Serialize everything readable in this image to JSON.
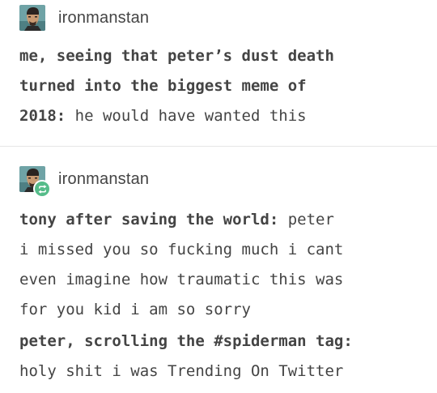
{
  "posts": [
    {
      "username": "ironmanstan",
      "reblogged": false,
      "lines": [
        {
          "bold": "me, seeing that peter’s dust death",
          "normal": ""
        },
        {
          "bold": "turned into the biggest meme of",
          "normal": ""
        },
        {
          "bold": "2018:",
          "normal": " he would have wanted this"
        }
      ]
    },
    {
      "username": "ironmanstan",
      "reblogged": true,
      "quotes": [
        {
          "lines": [
            {
              "bold": "tony after saving the world:",
              "normal": " peter"
            },
            {
              "bold": "",
              "normal": "i missed you so fucking much i cant"
            },
            {
              "bold": "",
              "normal": "even imagine how traumatic this was"
            },
            {
              "bold": "",
              "normal": "for you kid i am so sorry"
            }
          ]
        },
        {
          "lines": [
            {
              "bold": "peter, scrolling the #spiderman tag:",
              "normal": ""
            },
            {
              "bold": "",
              "normal": "holy shit i was Trending On Twitter"
            }
          ]
        }
      ]
    }
  ],
  "icons": {
    "avatar": "avatar-icon",
    "reblog": "reblog-icon"
  },
  "colors": {
    "text": "#444444",
    "reblog_badge": "#56bc8a",
    "avatar_bg": "#6fa3a6",
    "divider": "#e6e6e6"
  }
}
